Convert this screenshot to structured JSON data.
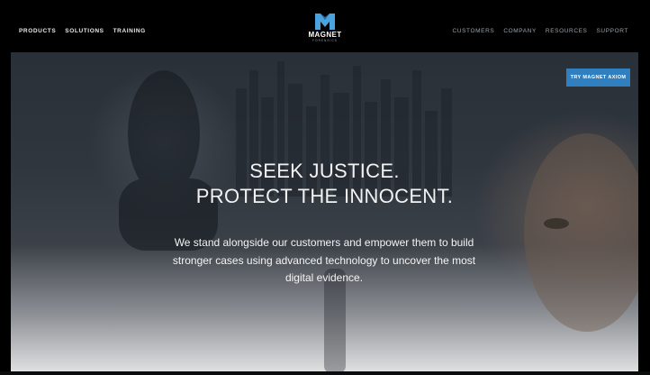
{
  "header": {
    "nav_left": [
      "PRODUCTS",
      "SOLUTIONS",
      "TRAINING"
    ],
    "nav_right": [
      "CUSTOMERS",
      "COMPANY",
      "RESOURCES",
      "SUPPORT"
    ],
    "logo": {
      "word": "MAGNET",
      "sub": "FORENSICS"
    }
  },
  "hero": {
    "cta_label": "TRY MAGNET AXIOM",
    "headline_line1": "SEEK JUSTICE.",
    "headline_line2": "PROTECT THE INNOCENT.",
    "subtext": "We stand alongside our customers and empower them to build stronger cases using advanced technology to uncover the most digital evidence."
  },
  "colors": {
    "accent": "#2f7fc1",
    "header_bg": "#000000",
    "logo_blue": "#4aa3df"
  }
}
